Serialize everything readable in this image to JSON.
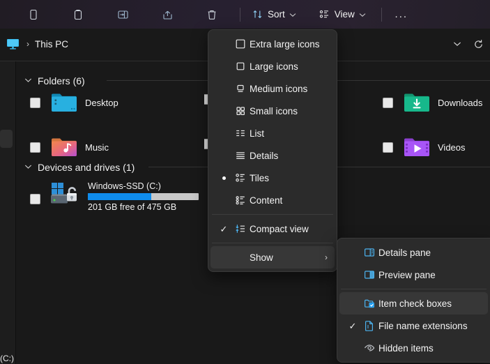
{
  "toolbar": {
    "icons": [
      {
        "name": "copy-icon",
        "label": "Copy"
      },
      {
        "name": "paste-icon",
        "label": "Paste"
      },
      {
        "name": "rename-icon",
        "label": "Rename"
      },
      {
        "name": "share-icon",
        "label": "Share"
      },
      {
        "name": "delete-icon",
        "label": "Delete"
      }
    ],
    "sort_label": "Sort",
    "view_label": "View",
    "more_label": "...",
    "chevron": "⌄"
  },
  "address": {
    "pc_icon": "this-pc-icon",
    "separator": "›",
    "crumb": "This PC",
    "dropdown_icon": "chevron-down-icon",
    "refresh_icon": "refresh-icon"
  },
  "navpane": {
    "partial_label": "(C:)"
  },
  "content": {
    "groups": [
      {
        "title": "Folders (6)",
        "chevron": "∨",
        "items": [
          {
            "label": "Desktop",
            "icon": "folder-desktop-icon",
            "checked": false
          },
          {
            "label": "Downloads",
            "icon": "folder-downloads-icon",
            "checked": false
          },
          {
            "label": "Music",
            "icon": "folder-music-icon",
            "checked": false
          },
          {
            "label": "Videos",
            "icon": "folder-videos-icon",
            "checked": false
          }
        ]
      },
      {
        "title": "Devices and drives (1)",
        "chevron": "∨",
        "drives": [
          {
            "name": "Windows-SSD (C:)",
            "free_text": "201 GB free of 475 GB",
            "used_percent": 57,
            "bar_fill_color": "#0f8cec",
            "bar_track_color": "#c8c8c8",
            "icon": "drive-windows-icon",
            "checked": false
          }
        ]
      }
    ]
  },
  "view_menu": {
    "items": [
      {
        "label": "Extra large icons",
        "icon": "extra-large-icons-icon",
        "mark": "none"
      },
      {
        "label": "Large icons",
        "icon": "large-icons-icon",
        "mark": "none"
      },
      {
        "label": "Medium icons",
        "icon": "medium-icons-icon",
        "mark": "none"
      },
      {
        "label": "Small icons",
        "icon": "small-icons-icon",
        "mark": "none"
      },
      {
        "label": "List",
        "icon": "list-view-icon",
        "mark": "none"
      },
      {
        "label": "Details",
        "icon": "details-view-icon",
        "mark": "none"
      },
      {
        "label": "Tiles",
        "icon": "tiles-view-icon",
        "mark": "radio"
      },
      {
        "label": "Content",
        "icon": "content-view-icon",
        "mark": "none"
      },
      {
        "label": "Compact view",
        "icon": "compact-view-icon",
        "mark": "check"
      }
    ],
    "show_label": "Show",
    "show_arrow": "›",
    "show_selected": true
  },
  "show_submenu": {
    "items": [
      {
        "label": "Details pane",
        "icon": "details-pane-icon",
        "mark": "none",
        "selected": false
      },
      {
        "label": "Preview pane",
        "icon": "preview-pane-icon",
        "mark": "none",
        "selected": false
      },
      {
        "label": "Item check boxes",
        "icon": "item-check-boxes-icon",
        "mark": "none",
        "selected": true
      },
      {
        "label": "File name extensions",
        "icon": "file-name-extensions-icon",
        "mark": "check",
        "selected": false
      },
      {
        "label": "Hidden items",
        "icon": "hidden-items-icon",
        "mark": "none",
        "selected": false
      }
    ]
  },
  "colors": {
    "accent": "#0f8cec",
    "menu_bg": "#2b2b2b",
    "window_bg": "#191919",
    "toolbar_bg": "#262030",
    "highlight": "#373737"
  }
}
